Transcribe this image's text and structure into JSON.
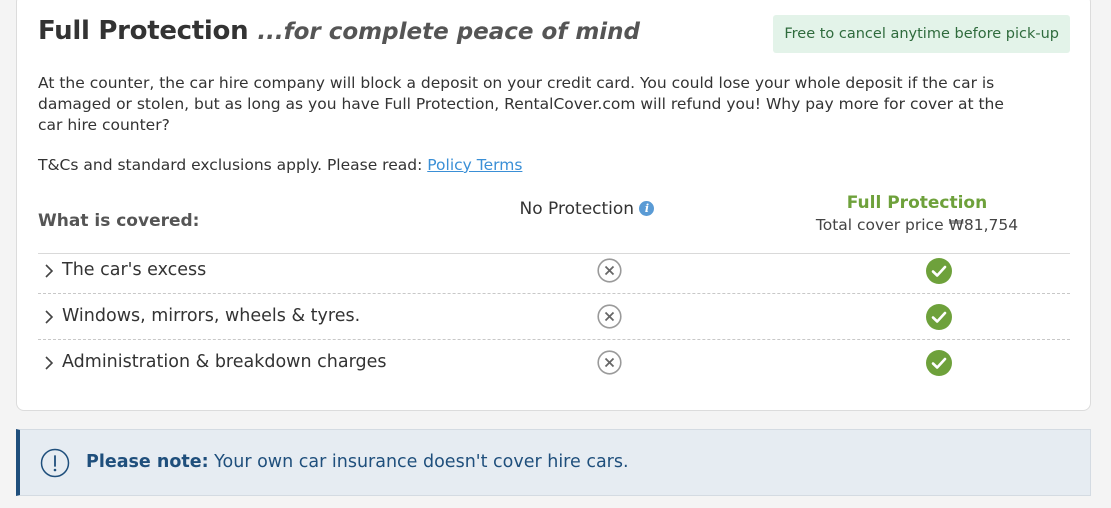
{
  "header": {
    "title": "Full Protection",
    "tagline": "...for complete peace of mind",
    "badge": "Free to cancel anytime before pick-up"
  },
  "description": "At the counter, the car hire company will block a deposit on your credit card. You could lose your whole deposit if the car is damaged or stolen, but as long as you have Full Protection, RentalCover.com will refund you! Why pay more for cover at the car hire counter?",
  "terms": {
    "text": "T&Cs and standard exclusions apply. Please read: ",
    "link_label": "Policy Terms"
  },
  "table": {
    "covered_label": "What is covered:",
    "no_protection_label": "No Protection",
    "full_protection_label": "Full Protection",
    "price_label": "Total cover price ₩81,754",
    "rows": [
      {
        "label": "The car's excess",
        "no_protection": "not-covered",
        "full_protection": "covered"
      },
      {
        "label": "Windows, mirrors, wheels & tyres.",
        "no_protection": "not-covered",
        "full_protection": "covered"
      },
      {
        "label": "Administration & breakdown charges",
        "no_protection": "not-covered",
        "full_protection": "covered"
      }
    ]
  },
  "note": {
    "strong": "Please note:",
    "text": " Your own car insurance doesn't cover hire cars."
  },
  "colors": {
    "accent_green": "#6ea13b",
    "link_blue": "#3a8fd6",
    "note_blue": "#1f4f7c",
    "badge_bg": "#e3f3e9"
  },
  "icons": {
    "info": "info-icon",
    "not_covered": "x-circle-icon",
    "covered": "check-circle-icon",
    "expand": "chevron-right-icon",
    "alert": "exclamation-circle-icon"
  }
}
